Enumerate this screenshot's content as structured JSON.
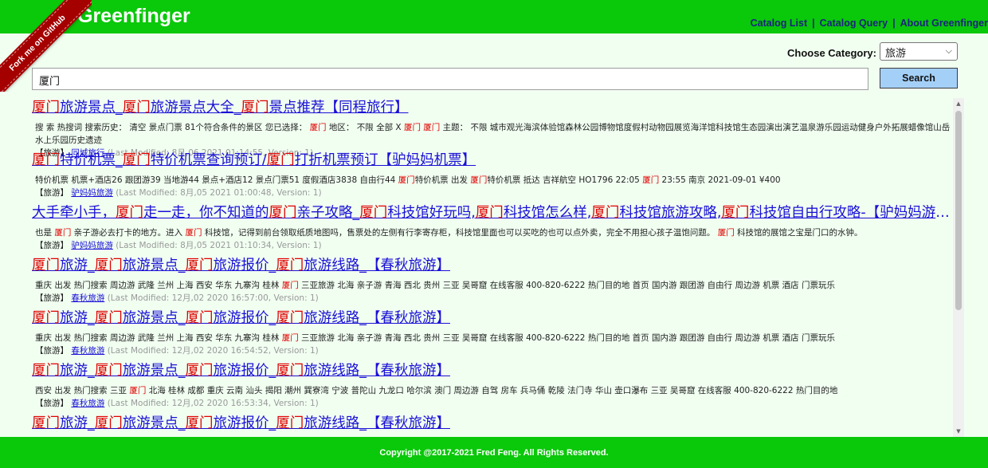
{
  "app": {
    "title": "Greenfinger"
  },
  "ribbon": {
    "label": "Fork me on GitHub"
  },
  "nav": {
    "items": [
      "Catalog List",
      "Catalog Query",
      "About Greenfinger"
    ],
    "separator": "|"
  },
  "category": {
    "label": "Choose Category:",
    "selected": "旅游"
  },
  "search": {
    "value": "厦门",
    "button_label": "Search"
  },
  "results": [
    {
      "title_parts": [
        [
          "厦门",
          1
        ],
        [
          "旅游景点_",
          0
        ],
        [
          "厦门",
          1
        ],
        [
          "旅游景点大全_",
          0
        ],
        [
          "厦门",
          1
        ],
        [
          "景点推荐【同程旅行】",
          0
        ]
      ],
      "snippet_parts": [
        [
          "搜 索 热搜词 搜索历史：  清空 景点门票 81个符合条件的景区 您已选择：  ",
          0
        ],
        [
          "厦门",
          1
        ],
        [
          " 地区：  不限 全部 X ",
          0
        ],
        [
          "厦门",
          1
        ],
        [
          " ",
          0
        ],
        [
          "厦门",
          1
        ],
        [
          " 主题：  不限 城市观光海滨体验馆森林公园博物馆度假村动物园展览海洋馆科技馆生态园演出演艺温泉游乐园运动健身户外拓展蜡像馆山岳水上乐园历史遗迹",
          0
        ]
      ],
      "category": "【旅游】",
      "source": "同城旅行",
      "meta": "(Last Modified: 8月,06 2021 01:14:55, Version: 1)"
    },
    {
      "title_parts": [
        [
          "厦门",
          1
        ],
        [
          "特价机票_",
          0
        ],
        [
          "厦门",
          1
        ],
        [
          "特价机票查询预订/",
          0
        ],
        [
          "厦门",
          1
        ],
        [
          "打折机票预订【驴妈妈机票】",
          0
        ]
      ],
      "snippet_parts": [
        [
          "特价机票 机票+酒店26 跟团游39 当地游44 景点+酒店12 景点门票51 度假酒店3838 自由行44 ",
          0
        ],
        [
          "厦门",
          1
        ],
        [
          "特价机票 出发 ",
          0
        ],
        [
          "厦门",
          1
        ],
        [
          "特价机票 抵达 吉祥航空 HO1796 22:05 ",
          0
        ],
        [
          "厦门",
          1
        ],
        [
          " 23:55 南京 2021-09-01 ¥400",
          0
        ]
      ],
      "category": "【旅游】",
      "source": "驴妈妈旅游",
      "meta": "(Last Modified: 8月,05 2021 01:00:48, Version: 1)"
    },
    {
      "title_parts": [
        [
          "大手牵小手，",
          0
        ],
        [
          "厦门",
          1
        ],
        [
          "走一走，你不知道的",
          0
        ],
        [
          "厦门",
          1
        ],
        [
          "亲子攻略_",
          0
        ],
        [
          "厦门",
          1
        ],
        [
          "科技馆好玩吗,",
          0
        ],
        [
          "厦门",
          1
        ],
        [
          "科技馆怎么样,",
          0
        ],
        [
          "厦门",
          1
        ],
        [
          "科技馆旅游攻略,",
          0
        ],
        [
          "厦门",
          1
        ],
        [
          "科技馆自由行攻略-【驴妈妈游记】",
          0
        ]
      ],
      "snippet_parts": [
        [
          "也是 ",
          0
        ],
        [
          "厦门",
          1
        ],
        [
          " 亲子游必去打卡的地方。进入 ",
          0
        ],
        [
          "厦门",
          1
        ],
        [
          " 科技馆，记得到前台领取纸质地图吗，售票处的左侧有行李寄存柜，科技馆里面也可以买吃的也可以点外卖，完全不用担心孩子温饱问题。 ",
          0
        ],
        [
          "厦门",
          1
        ],
        [
          " 科技馆的展馆之宝是门口的水钟。",
          0
        ]
      ],
      "category": "【旅游】",
      "source": "驴妈妈旅游",
      "meta": "(Last Modified: 8月,05 2021 01:10:34, Version: 1)"
    },
    {
      "title_parts": [
        [
          "厦门",
          1
        ],
        [
          "旅游_",
          0
        ],
        [
          "厦门",
          1
        ],
        [
          "旅游景点_",
          0
        ],
        [
          "厦门",
          1
        ],
        [
          "旅游报价_",
          0
        ],
        [
          "厦门",
          1
        ],
        [
          "旅游线路_【春秋旅游】",
          0
        ]
      ],
      "snippet_parts": [
        [
          "重庆 出发 热门搜索 周边游 武隆 兰州 上海 西安 华东 九寨沟 桂林 ",
          0
        ],
        [
          "厦门",
          1
        ],
        [
          " 三亚旅游 北海 亲子游 青海 西北 贵州 三亚 吴哥窟 在线客服 400-820-6222 热门目的地 首页 国内游 跟团游 自由行 周边游 机票 酒店 门票玩乐",
          0
        ]
      ],
      "category": "【旅游】",
      "source": "春秋旅游",
      "meta": "(Last Modified: 12月,02 2020 16:57:00, Version: 1)"
    },
    {
      "title_parts": [
        [
          "厦门",
          1
        ],
        [
          "旅游_",
          0
        ],
        [
          "厦门",
          1
        ],
        [
          "旅游景点_",
          0
        ],
        [
          "厦门",
          1
        ],
        [
          "旅游报价_",
          0
        ],
        [
          "厦门",
          1
        ],
        [
          "旅游线路_【春秋旅游】",
          0
        ]
      ],
      "snippet_parts": [
        [
          "重庆 出发 热门搜索 周边游 武隆 兰州 上海 西安 华东 九寨沟 桂林 ",
          0
        ],
        [
          "厦门",
          1
        ],
        [
          " 三亚旅游 北海 亲子游 青海 西北 贵州 三亚 吴哥窟 在线客服 400-820-6222 热门目的地 首页 国内游 跟团游 自由行 周边游 机票 酒店 门票玩乐",
          0
        ]
      ],
      "category": "【旅游】",
      "source": "春秋旅游",
      "meta": "(Last Modified: 12月,02 2020 16:54:52, Version: 1)"
    },
    {
      "title_parts": [
        [
          "厦门",
          1
        ],
        [
          "旅游_",
          0
        ],
        [
          "厦门",
          1
        ],
        [
          "旅游景点_",
          0
        ],
        [
          "厦门",
          1
        ],
        [
          "旅游报价_",
          0
        ],
        [
          "厦门",
          1
        ],
        [
          "旅游线路_【春秋旅游】",
          0
        ]
      ],
      "snippet_parts": [
        [
          "西安 出发 热门搜索 三亚 ",
          0
        ],
        [
          "厦门",
          1
        ],
        [
          " 北海 桂林 成都 重庆 云南 汕头 揭阳 潮州 巽寮湾 宁波 普陀山 九龙口 哈尔滨 澳门 周边游 自驾 房车 兵马俑 乾陵 法门寺 华山 壶口瀑布 三亚 吴哥窟 在线客服 400-820-6222 热门目的地",
          0
        ]
      ],
      "category": "【旅游】",
      "source": "春秋旅游",
      "meta": "(Last Modified: 12月,02 2020 16:53:34, Version: 1)"
    },
    {
      "title_parts": [
        [
          "厦门",
          1
        ],
        [
          "旅游_",
          0
        ],
        [
          "厦门",
          1
        ],
        [
          "旅游景点_",
          0
        ],
        [
          "厦门",
          1
        ],
        [
          "旅游报价_",
          0
        ],
        [
          "厦门",
          1
        ],
        [
          "旅游线路_【春秋旅游】",
          0
        ]
      ],
      "snippet_parts": [],
      "category": "",
      "source": "",
      "meta": ""
    }
  ],
  "footer": {
    "text": "Copyright @2017-2021 Fred Feng. All Rights Reserved."
  },
  "colors": {
    "header_green": "#0ac80a",
    "background": "#f1fff1",
    "highlight": "#e00000",
    "link": "#1a10d6",
    "ribbon": "#a50000",
    "button": "#a4d0f7"
  },
  "icons": {
    "select_caret": "chevron-down-icon",
    "scroll_up": "arrow-up-icon",
    "scroll_down": "arrow-down-icon"
  }
}
